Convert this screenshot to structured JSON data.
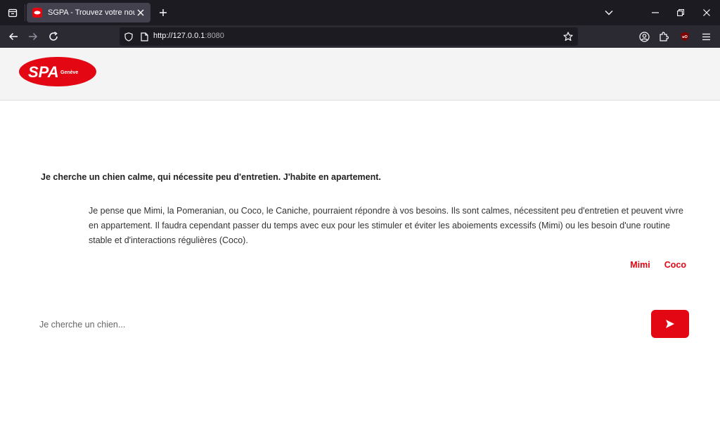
{
  "browser": {
    "tab_title": "SGPA - Trouvez votre nouveau compagnon",
    "url_main": "http://127.0.0.1",
    "url_port": ":8080"
  },
  "logo": {
    "text_main": "SPA",
    "text_sub": "Genève",
    "color": "#e30613"
  },
  "chat": {
    "question": "Je cherche un chien calme, qui nécessite peu d'entretien. J'habite en apartement.",
    "answer": "Je pense que Mimi, la Pomeranian, ou Coco, le Caniche, pourraient répondre à vos besoins. Ils sont calmes, nécessitent peu d'entretien et peuvent vivre en appartement. Il faudra cependant passer du temps avec eux pour les stimuler et éviter les aboiements excessifs (Mimi) ou les besoin d'une routine stable et d'interactions régulières (Coco).",
    "links": [
      "Mimi",
      "Coco"
    ],
    "input_placeholder": "Je cherche un chien...",
    "send_icon": "send-icon"
  },
  "colors": {
    "accent": "#e30613",
    "chrome_dark": "#1c1b22",
    "chrome_toolbar": "#2b2a33",
    "header_bg": "#f4f4f4"
  }
}
